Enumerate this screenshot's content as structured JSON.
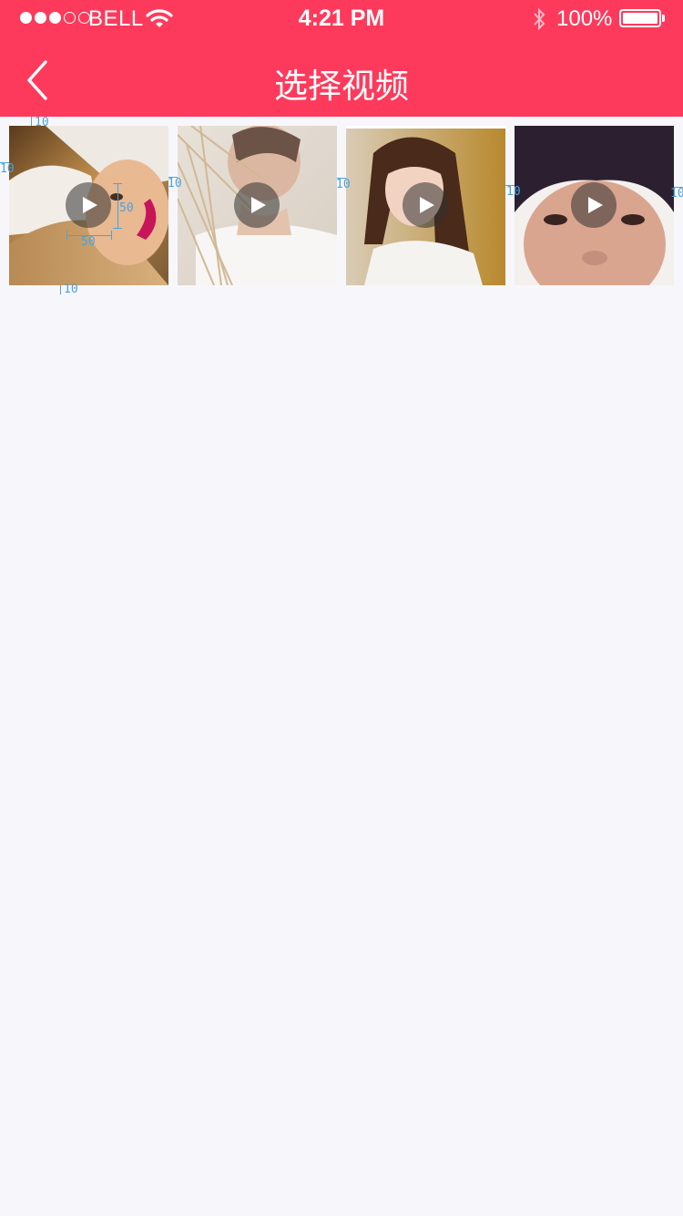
{
  "status_bar": {
    "carrier": "BELL",
    "time": "4:21 PM",
    "battery": "100%",
    "signal_filled": 3,
    "signal_total": 5,
    "icons": [
      "wifi-icon",
      "bluetooth-icon",
      "battery-icon"
    ]
  },
  "header": {
    "title": "选择视频",
    "back_icon": "chevron-left-icon",
    "background": "#fe3a5c"
  },
  "videos": [
    {
      "name": "video-1",
      "play_icon": "play-icon"
    },
    {
      "name": "video-2",
      "play_icon": "play-icon"
    },
    {
      "name": "video-3",
      "play_icon": "play-icon"
    },
    {
      "name": "video-4",
      "play_icon": "play-icon"
    }
  ],
  "annotations": {
    "top_gap": "10",
    "left_gap": "10",
    "gap_1": "10",
    "gap_2": "10",
    "gap_3": "10",
    "right_gap": "10",
    "bottom_gap": "10",
    "play_width": "50",
    "play_height": "50"
  },
  "colors": {
    "accent": "#fe3a5c",
    "page_background": "#f7f7fb",
    "annotation": "#4aa3df"
  }
}
